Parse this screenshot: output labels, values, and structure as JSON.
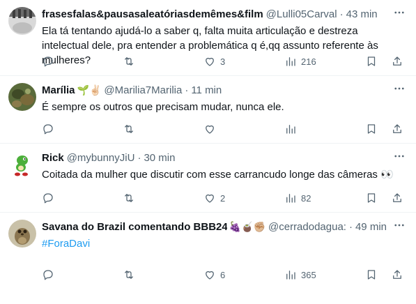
{
  "tweets": [
    {
      "name": "frasesfalas&pausasaleatóriasdemêmes&film",
      "emoji": "",
      "handle": "@Lulli05Carval",
      "dot": "·",
      "time": "43 min",
      "text": "Ela tá tentando ajudá-lo a saber q, falta muita articulação e destreza intelectual dele, pra entender a problemática q é,qq assunto referente às mulheres?",
      "replies": "",
      "retweets": "",
      "likes": "3",
      "views": "216"
    },
    {
      "name": "Marília",
      "emoji": "🌱✌🏻",
      "handle": "@Marilia7Marilia",
      "dot": "·",
      "time": "11 min",
      "text": "É sempre os outros que precisam mudar, nunca ele.",
      "replies": "",
      "retweets": "",
      "likes": "",
      "views": ""
    },
    {
      "name": "Rick",
      "emoji": "",
      "handle": "@mybunnyJiU",
      "dot": "·",
      "time": "30 min",
      "text": "Coitada da mulher que discutir com esse carrancudo longe das câmeras 👀",
      "replies": "",
      "retweets": "",
      "likes": "2",
      "views": "82"
    },
    {
      "name": "Savana do Brazil comentando BBB24",
      "emoji": "🍇🧉✊🏼",
      "handle": "@cerradodagua:",
      "dot": "·",
      "time": "49 min",
      "text": "#ForaDavi",
      "replies": "",
      "retweets": "",
      "likes": "6",
      "views": "365"
    }
  ],
  "colors": {
    "text": "#0f1419",
    "muted": "#536471",
    "link": "#1d9bf0",
    "divider": "#eff3f4"
  },
  "icons": {
    "reply": "reply-icon",
    "retweet": "retweet-icon",
    "like": "heart-icon",
    "views": "views-icon",
    "bookmark": "bookmark-icon",
    "share": "share-icon",
    "more": "more-icon"
  }
}
